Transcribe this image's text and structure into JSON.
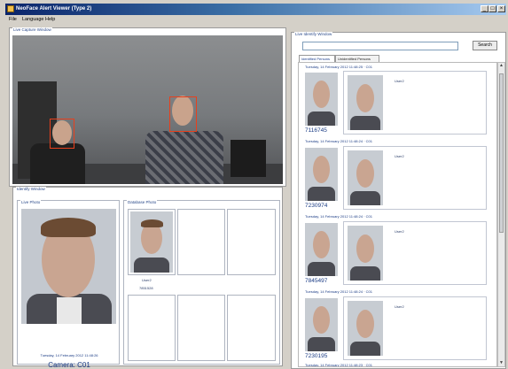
{
  "window": {
    "title": "NeoFace Alert Viewer (Type 2)"
  },
  "menu": {
    "items": [
      "File",
      "Language",
      "Help"
    ]
  },
  "live_capture": {
    "title": "Live Capture Window"
  },
  "identify": {
    "title": "Identify Window",
    "live_photo_title": "Live Photo",
    "database_photo_title": "Database Photo",
    "live_timestamp": "Tuesday, 14 February 2012 11:48:26",
    "camera_label": "Camera: C01",
    "match_name": "User2",
    "match_id": "7851528"
  },
  "live_identify": {
    "title": "Live Identify Window",
    "search_placeholder": "",
    "search_button": "Search",
    "tabs": [
      "Identified Persons",
      "Unidentified Persons"
    ],
    "entries": [
      {
        "header": "Tuesday, 14 February 2012 11:48:25 · C01",
        "id": "7116745",
        "user": "User2"
      },
      {
        "header": "Tuesday, 14 February 2012 11:48:24 · C01",
        "id": "7230974",
        "user": "User2"
      },
      {
        "header": "Tuesday, 14 February 2012 11:48:24 · C01",
        "id": "7845497",
        "user": "User2"
      },
      {
        "header": "Tuesday, 14 February 2012 11:48:24 · C01",
        "id": "7230195",
        "user": "User2"
      }
    ],
    "partial_entry_header": "Tuesday, 14 February 2012 11:48:23 · C01"
  },
  "colors": {
    "title_bar": "#0a246a",
    "face_box": "#e8401c",
    "label_blue": "#1b3c85"
  },
  "icons": {
    "app": "app-icon",
    "minimize": "minimize-icon",
    "maximize": "maximize-icon",
    "close": "close-icon"
  }
}
